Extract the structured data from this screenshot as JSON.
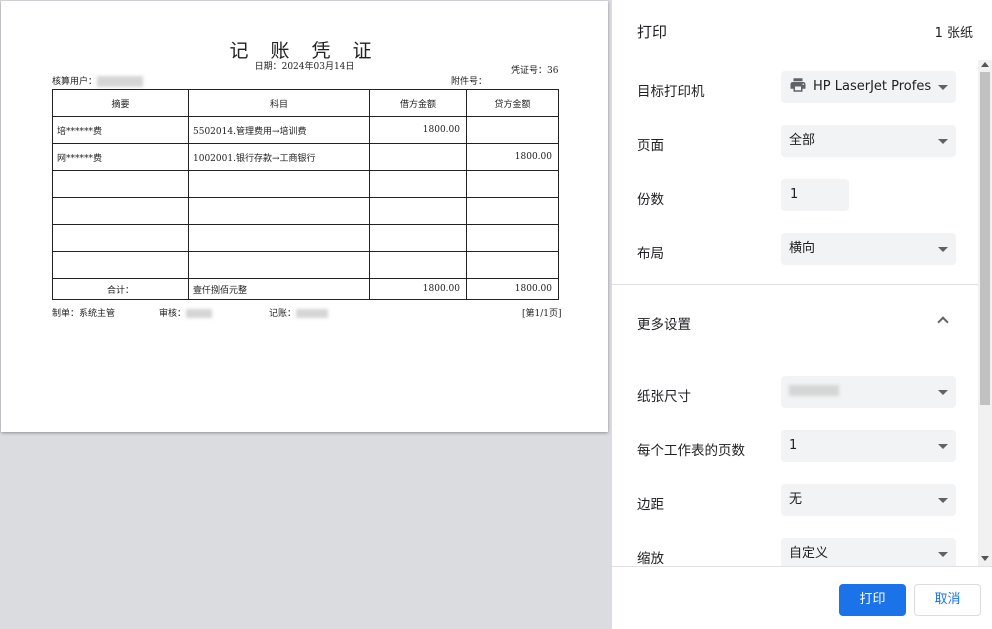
{
  "voucher": {
    "title": "记 账 凭 证",
    "date": "日期：2024年03月14日",
    "voucher_no": "凭证号：36",
    "accounting_user_label": "核算用户：",
    "attachments_label": "附件号：",
    "columns": [
      "摘要",
      "科目",
      "借方金额",
      "贷方金额"
    ],
    "rows": [
      [
        "培******费",
        "5502014.管理费用→培训费",
        "1800.00",
        ""
      ],
      [
        "网******费",
        "1002001.银行存款→工商银行",
        "",
        "1800.00"
      ],
      [
        "",
        "",
        "",
        ""
      ],
      [
        "",
        "",
        "",
        ""
      ],
      [
        "",
        "",
        "",
        ""
      ],
      [
        "",
        "",
        "",
        ""
      ]
    ],
    "total": {
      "label": "合计：",
      "amount_words": "壹仟捌佰元整",
      "debit": "1800.00",
      "credit": "1800.00"
    },
    "footer": {
      "maker": "制单：系统主管",
      "auditor": "审核：",
      "keeper": "记账：",
      "page": "[第1/1页]"
    }
  },
  "panel": {
    "title": "打印",
    "sheet_count": "1 张纸",
    "settings": {
      "destination": {
        "label": "目标打印机",
        "value": "HP LaserJet Profes",
        "icon": "printer-icon"
      },
      "pages": {
        "label": "页面",
        "value": "全部"
      },
      "copies": {
        "label": "份数",
        "value": "1"
      },
      "layout": {
        "label": "布局",
        "value": "横向"
      },
      "more": {
        "label": "更多设置"
      },
      "paper_size": {
        "label": "纸张尺寸",
        "value": ""
      },
      "pages_per_sheet": {
        "label": "每个工作表的页数",
        "value": "1"
      },
      "margins": {
        "label": "边距",
        "value": "无"
      },
      "scale": {
        "label": "缩放",
        "value": "自定义"
      }
    },
    "buttons": {
      "print": "打印",
      "cancel": "取消"
    }
  },
  "colors": {
    "accent": "#1a73e8",
    "preview_bg": "#dadce0",
    "field_bg": "#f1f3f4"
  }
}
